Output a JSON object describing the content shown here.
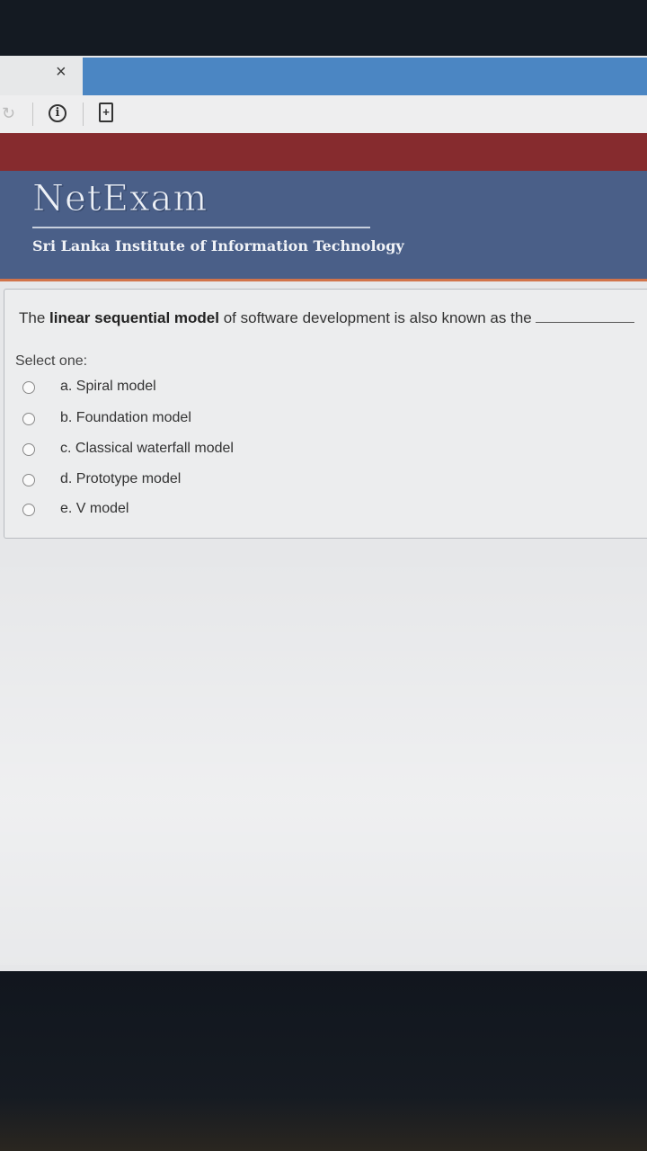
{
  "browser": {
    "close_glyph": "×",
    "reload_icon": "reload-icon",
    "info_icon": "info-icon",
    "info_glyph": "i",
    "page_icon": "page-add-icon",
    "page_glyph": "+"
  },
  "header": {
    "logo": "NetExam",
    "institute": "Sri Lanka Institute of Information Technology"
  },
  "question": {
    "prefix": "The ",
    "bold": "linear sequential model",
    "suffix": " of software development is also known as the",
    "prompt": "Select one:",
    "options": [
      {
        "label": "a. Spiral model"
      },
      {
        "label": "b. Foundation model"
      },
      {
        "label": "c. Classical waterfall model"
      },
      {
        "label": "d. Prototype  model"
      },
      {
        "label": "e. V model"
      }
    ]
  },
  "colors": {
    "tab_blue": "#4b86c3",
    "red_band": "#862b2e",
    "header_blue": "#4a5f88",
    "accent_orange": "#d1734a"
  }
}
